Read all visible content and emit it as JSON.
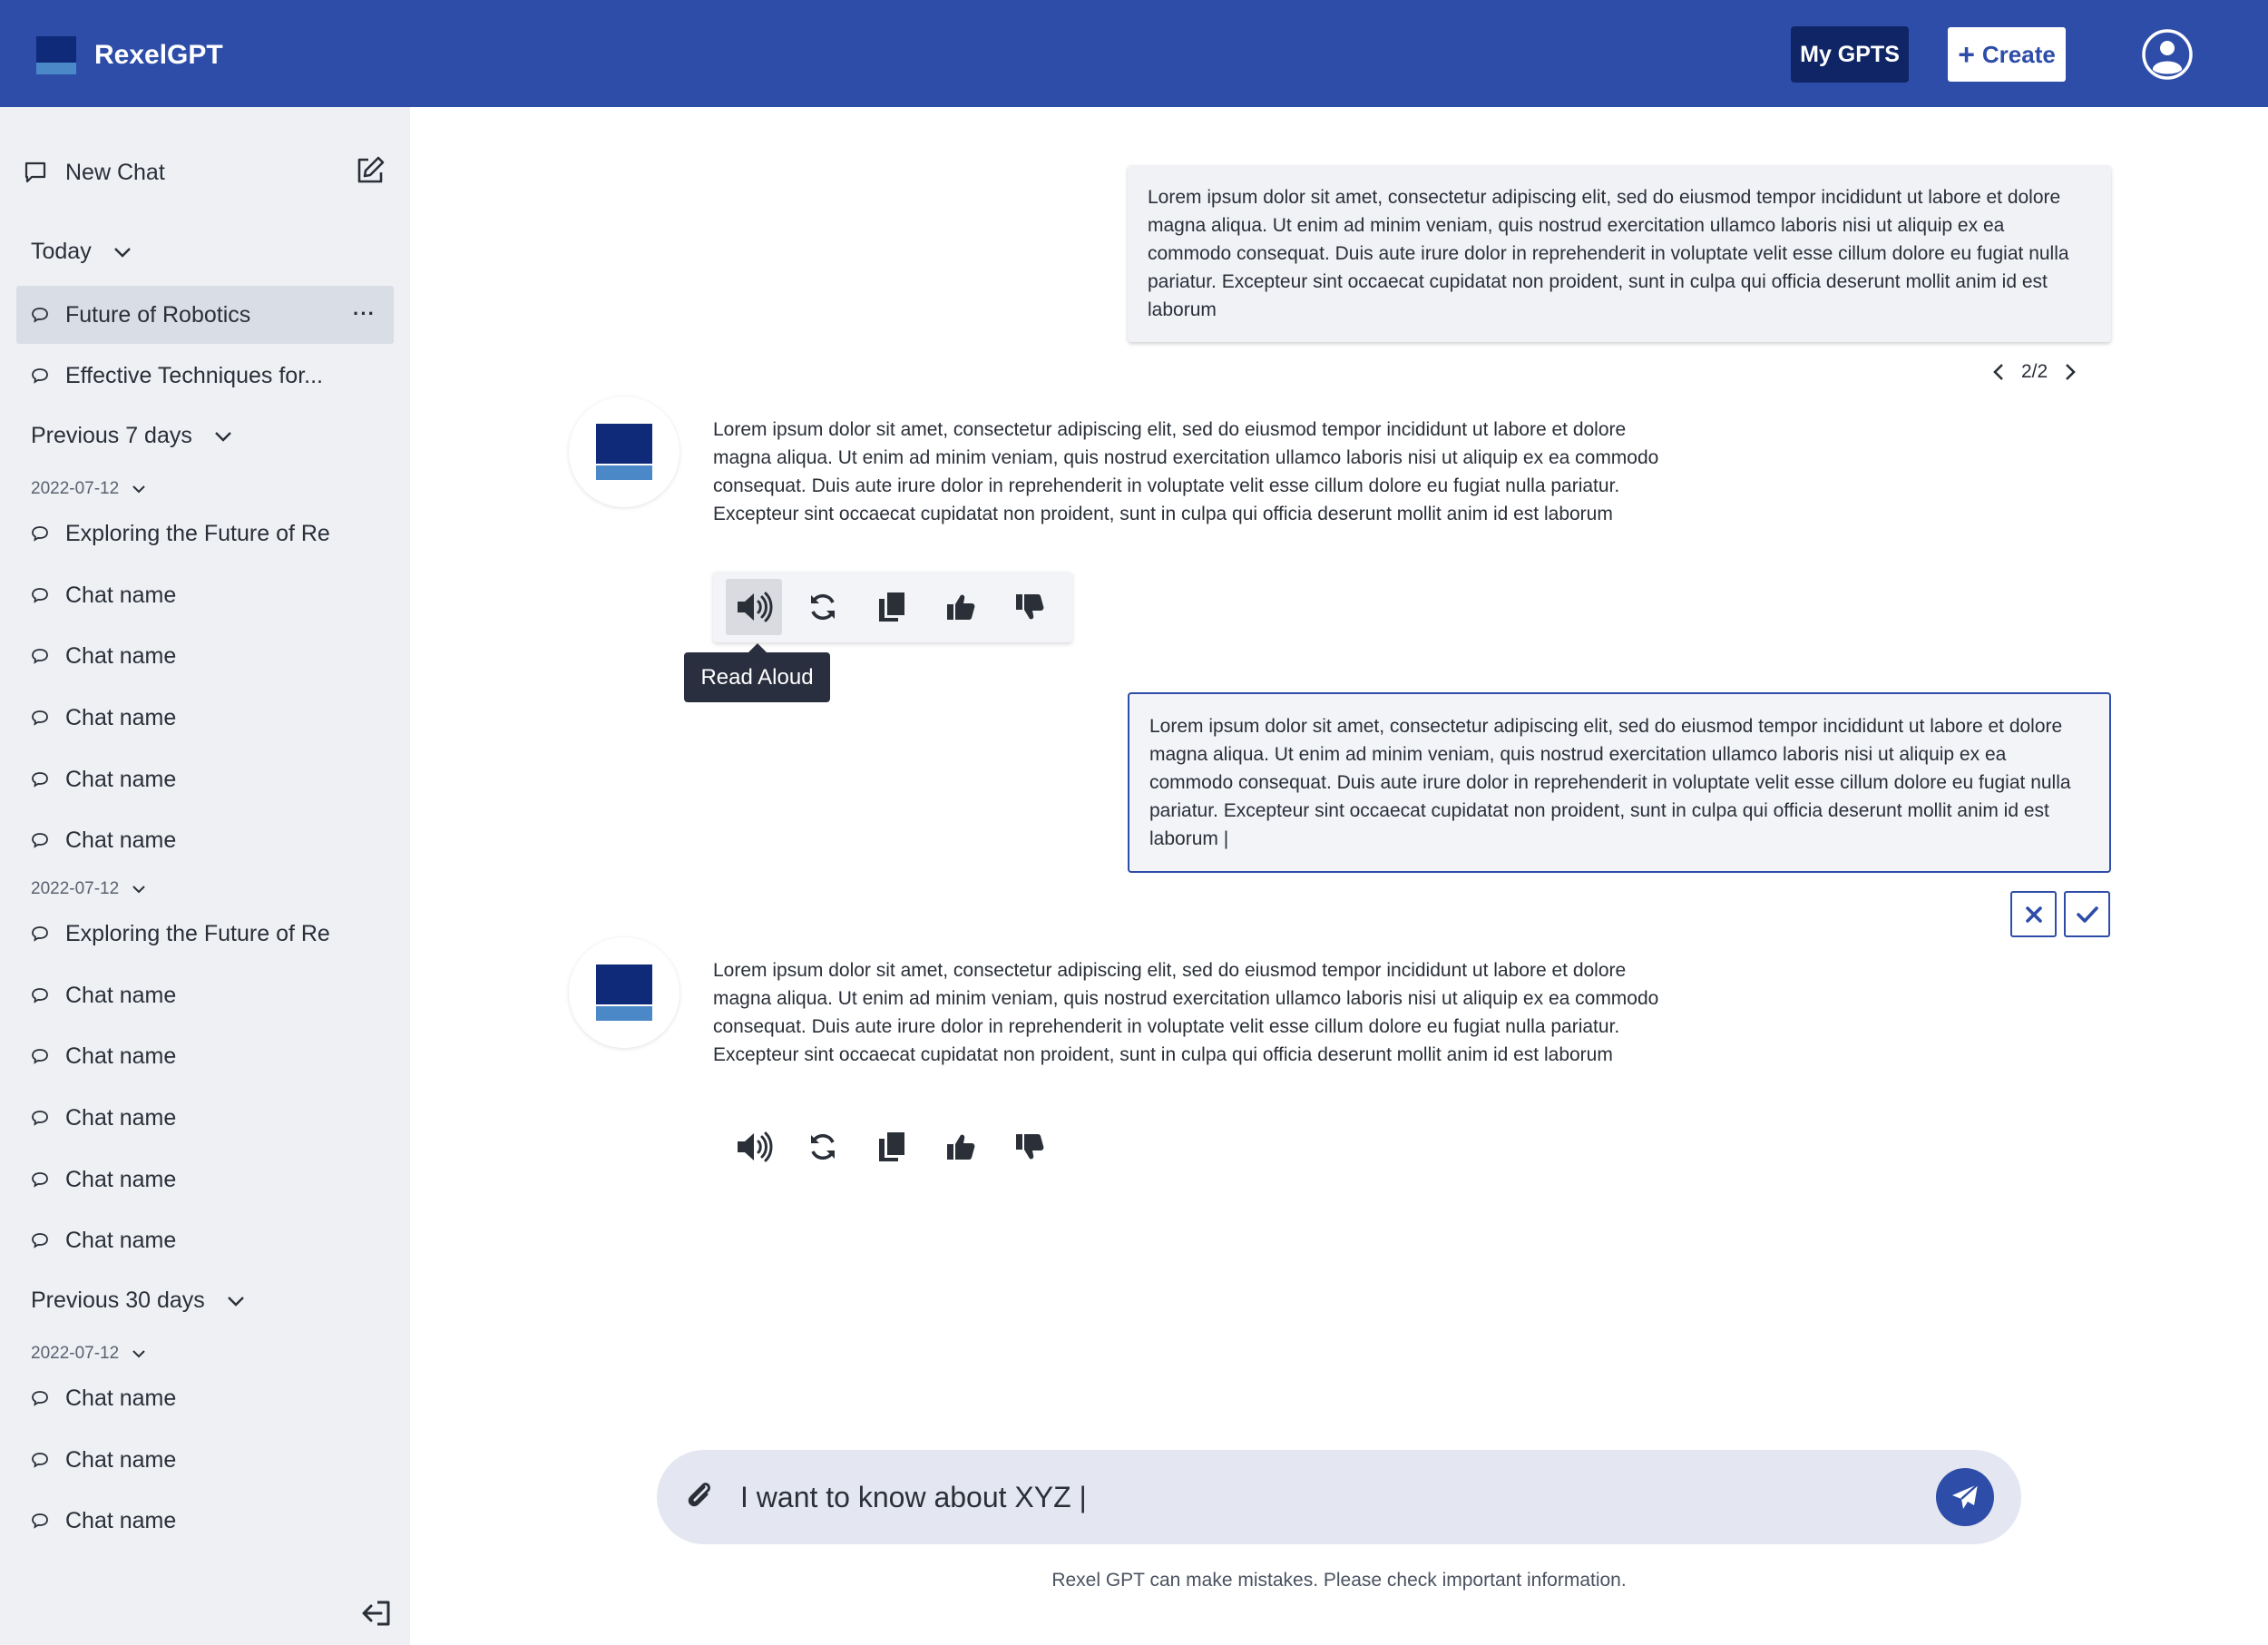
{
  "header": {
    "app_name": "RexelGPT",
    "my_gpts_label": "My GPTS",
    "create_label": "Create"
  },
  "sidebar": {
    "new_chat_label": "New Chat",
    "groups": {
      "today": "Today",
      "previous_7": "Previous 7 days",
      "previous_30": "Previous 30 days"
    },
    "dates": [
      "2022-07-12",
      "2022-07-12",
      "2022-07-12"
    ],
    "today_items": [
      "Future of Robotics",
      "Effective Techniques for..."
    ],
    "prev7_a": [
      "Exploring the Future of Re",
      "Chat name",
      "Chat name",
      "Chat name",
      "Chat name",
      "Chat name"
    ],
    "prev7_b": [
      "Exploring the Future of Re",
      "Chat name",
      "Chat name",
      "Chat name",
      "Chat name",
      "Chat name"
    ],
    "prev30": [
      "Chat name",
      "Chat name",
      "Chat name"
    ],
    "more_label": "···"
  },
  "conversation": {
    "user_msg_1": "Lorem ipsum dolor sit amet, consectetur adipiscing elit, sed do eiusmod tempor incididunt ut labore et dolore magna aliqua. Ut enim ad minim veniam, quis nostrud exercitation ullamco laboris nisi ut aliquip ex ea commodo consequat. Duis aute irure dolor in reprehenderit in voluptate velit esse cillum dolore eu fugiat nulla pariatur. Excepteur sint occaecat cupidatat non proident, sunt in culpa qui officia deserunt mollit anim id est laborum",
    "pager": "2/2",
    "bot_msg_1": "Lorem ipsum dolor sit amet, consectetur adipiscing elit, sed do eiusmod tempor incididunt ut labore et dolore magna aliqua. Ut enim ad minim veniam, quis nostrud exercitation ullamco laboris nisi ut aliquip ex ea commodo consequat. Duis aute irure dolor in reprehenderit in voluptate velit esse cillum dolore eu fugiat nulla pariatur. Excepteur sint occaecat cupidatat non proident, sunt in culpa qui officia deserunt mollit anim id est laborum",
    "tooltip": "Read Aloud",
    "user_msg_2": "Lorem ipsum dolor sit amet, consectetur adipiscing elit, sed do eiusmod tempor incididunt ut labore et dolore magna aliqua. Ut enim ad minim veniam, quis nostrud exercitation ullamco laboris nisi ut aliquip ex ea commodo consequat. Duis aute irure dolor in reprehenderit in voluptate velit esse cillum dolore eu fugiat nulla pariatur. Excepteur sint occaecat cupidatat non proident, sunt in culpa qui officia deserunt mollit anim id est laborum |",
    "bot_msg_2": "Lorem ipsum dolor sit amet, consectetur adipiscing elit, sed do eiusmod tempor incididunt ut labore et dolore magna aliqua. Ut enim ad minim veniam, quis nostrud exercitation ullamco laboris nisi ut aliquip ex ea commodo consequat. Duis aute irure dolor in reprehenderit in voluptate velit esse cillum dolore eu fugiat nulla pariatur. Excepteur sint occaecat cupidatat non proident, sunt in culpa qui officia deserunt mollit anim id est laborum"
  },
  "composer": {
    "value": "I want to know about XYZ |"
  },
  "footer": {
    "disclaimer": "Rexel GPT can make mistakes. Please check important information."
  },
  "icons": {
    "chat": "speech-bubble-icon",
    "edit": "pen-square-icon",
    "read_aloud": "speaker-icon",
    "regenerate": "refresh-icon",
    "copy": "copy-icon",
    "like": "thumbs-up-icon",
    "dislike": "thumbs-down-icon",
    "attach": "paperclip-icon",
    "send": "paper-plane-icon",
    "logout": "logout-icon",
    "account": "user-circle-icon"
  },
  "colors": {
    "brand": "#2e4da8",
    "brand_dark": "#0f2566",
    "sidebar_bg": "#eef0f4",
    "active_item": "#d9dde6"
  }
}
